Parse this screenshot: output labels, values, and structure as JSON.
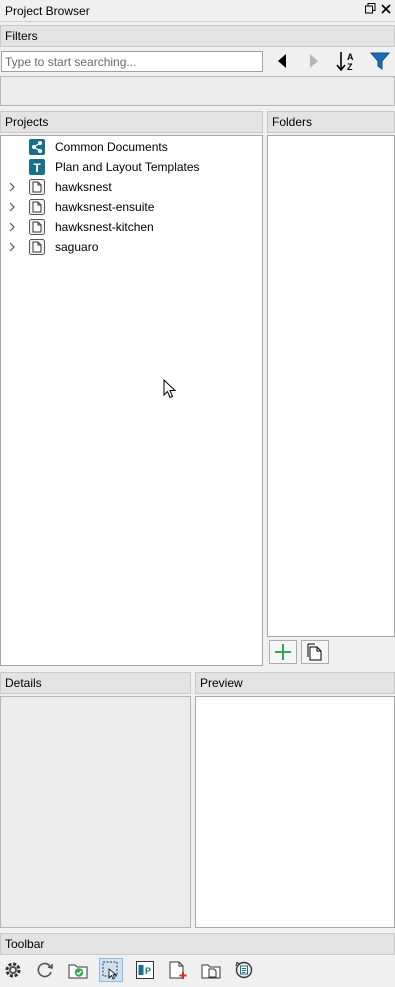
{
  "window": {
    "title": "Project Browser",
    "restore_glyph": "🗗",
    "close_glyph": "✕"
  },
  "filters": {
    "header": "Filters",
    "search_placeholder": "Type to start searching..."
  },
  "projects": {
    "header": "Projects",
    "items": [
      {
        "label": "Common Documents",
        "icon": "share-icon",
        "expandable": false
      },
      {
        "label": "Plan and Layout Templates",
        "icon": "template-icon",
        "expandable": false
      },
      {
        "label": "hawksnest",
        "icon": "project-icon",
        "expandable": true
      },
      {
        "label": "hawksnest-ensuite",
        "icon": "project-icon",
        "expandable": true
      },
      {
        "label": "hawksnest-kitchen",
        "icon": "project-icon",
        "expandable": true
      },
      {
        "label": "saguaro",
        "icon": "project-icon",
        "expandable": true
      }
    ]
  },
  "folders": {
    "header": "Folders"
  },
  "details": {
    "header": "Details"
  },
  "preview": {
    "header": "Preview"
  },
  "toolbar": {
    "header": "Toolbar",
    "icons": [
      "settings-gear-icon",
      "refresh-icon",
      "open-folder-check-icon",
      "select-layout-icon",
      "plan-layout-icon",
      "new-layout-icon",
      "folder-document-icon",
      "restore-backup-icon"
    ]
  },
  "colors": {
    "accent_teal": "#1b6f86",
    "filter_blue": "#1a6fb5",
    "add_green": "#2fa84f"
  }
}
